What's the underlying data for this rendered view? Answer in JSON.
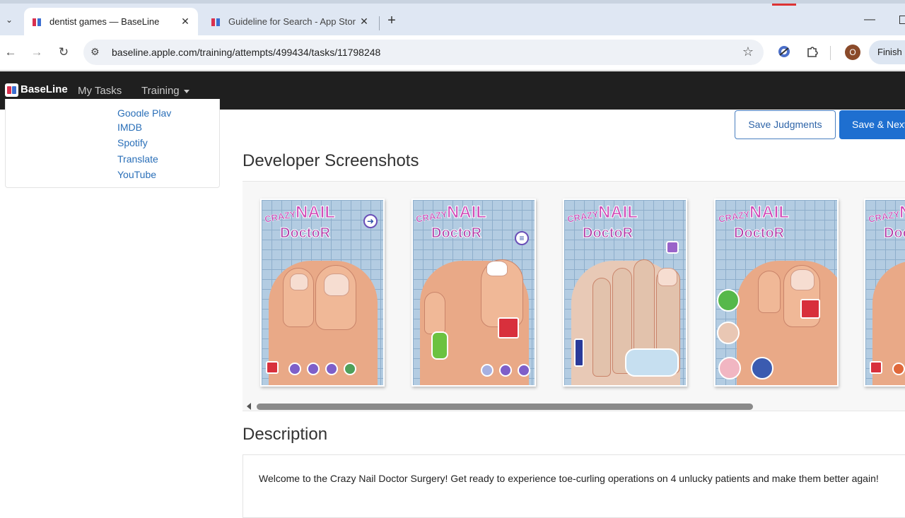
{
  "browser": {
    "tabs": [
      {
        "title": "dentist games — BaseLine",
        "active": true
      },
      {
        "title": "Guideline for Search - App Stor",
        "active": false
      }
    ],
    "url": "baseline.apple.com/training/attempts/499434/tasks/11798248",
    "profile_initial": "O",
    "finish_label": "Finish u",
    "icons": {
      "tab_menu": "chevron-down-icon",
      "new_tab": "plus-icon",
      "back": "arrow-left-icon",
      "forward": "arrow-right-icon",
      "reload": "reload-icon",
      "site_info": "tune-icon",
      "bookmark": "star-icon",
      "extension1": "globe-extension-icon",
      "extensions": "puzzle-icon"
    }
  },
  "app": {
    "logo": "BaseLine",
    "nav": {
      "my_tasks": "My Tasks",
      "training": "Training"
    },
    "accent": "#1e6fd0"
  },
  "sidebar": {
    "links": [
      "Google Play",
      "IMDB",
      "Spotify",
      "Translate",
      "YouTube"
    ]
  },
  "actions": {
    "save_judgments": "Save Judgments",
    "save_next": "Save & Next"
  },
  "developer_screenshots": {
    "heading": "Developer Screenshots",
    "items": [
      {
        "logo_top": "CRAZY",
        "logo_mid": "NAIL",
        "logo_bot": "DoctoR",
        "badge": "➜"
      },
      {
        "logo_top": "CRAZY",
        "logo_mid": "NAIL",
        "logo_bot": "DoctoR",
        "badge": "≡"
      },
      {
        "logo_top": "CRAZY",
        "logo_mid": "NAIL",
        "logo_bot": "DoctoR",
        "badge": ""
      },
      {
        "logo_top": "CRAZY",
        "logo_mid": "NAIL",
        "logo_bot": "DoctoR",
        "badge": ""
      },
      {
        "logo_top": "CRAZY",
        "logo_mid": "NAIL",
        "logo_bot": "DoctoR",
        "badge": ""
      }
    ]
  },
  "description": {
    "heading": "Description",
    "text": "Welcome to the Crazy Nail Doctor Surgery! Get ready to experience toe-curling operations on 4 unlucky patients and make them better again!"
  }
}
